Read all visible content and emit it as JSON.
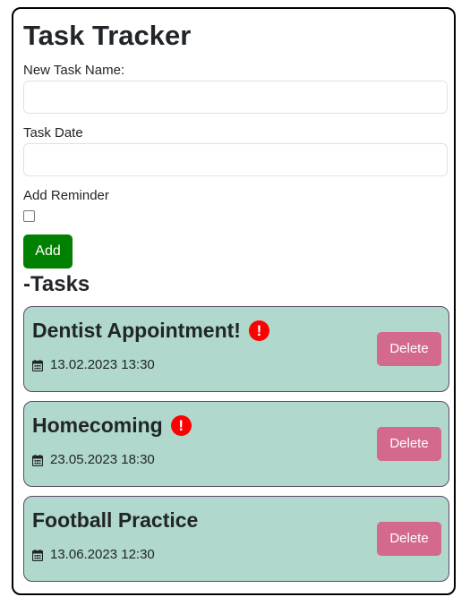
{
  "app": {
    "title": "Task Tracker"
  },
  "form": {
    "task_name_label": "New Task Name:",
    "task_name_value": "",
    "task_date_label": "Task Date",
    "task_date_value": "",
    "reminder_label": "Add Reminder",
    "reminder_checked": false,
    "add_button_label": "Add"
  },
  "tasks_section": {
    "title": "-Tasks"
  },
  "tasks": [
    {
      "name": "Dentist Appointment!",
      "date": "13.02.2023 13:30",
      "reminder": true,
      "delete_label": "Delete"
    },
    {
      "name": "Homecoming",
      "date": "23.05.2023 18:30",
      "reminder": true,
      "delete_label": "Delete"
    },
    {
      "name": "Football Practice",
      "date": "13.06.2023 12:30",
      "reminder": false,
      "delete_label": "Delete"
    }
  ],
  "icons": {
    "reminder": "exclamation-circle-icon",
    "date": "calendar-icon",
    "reminder_glyph": "!"
  },
  "colors": {
    "add_button": "#008000",
    "task_background": "#b0d8cc",
    "task_border": "#5b4a6a",
    "delete_button": "#d3698c",
    "reminder_icon": "#ff0000"
  }
}
